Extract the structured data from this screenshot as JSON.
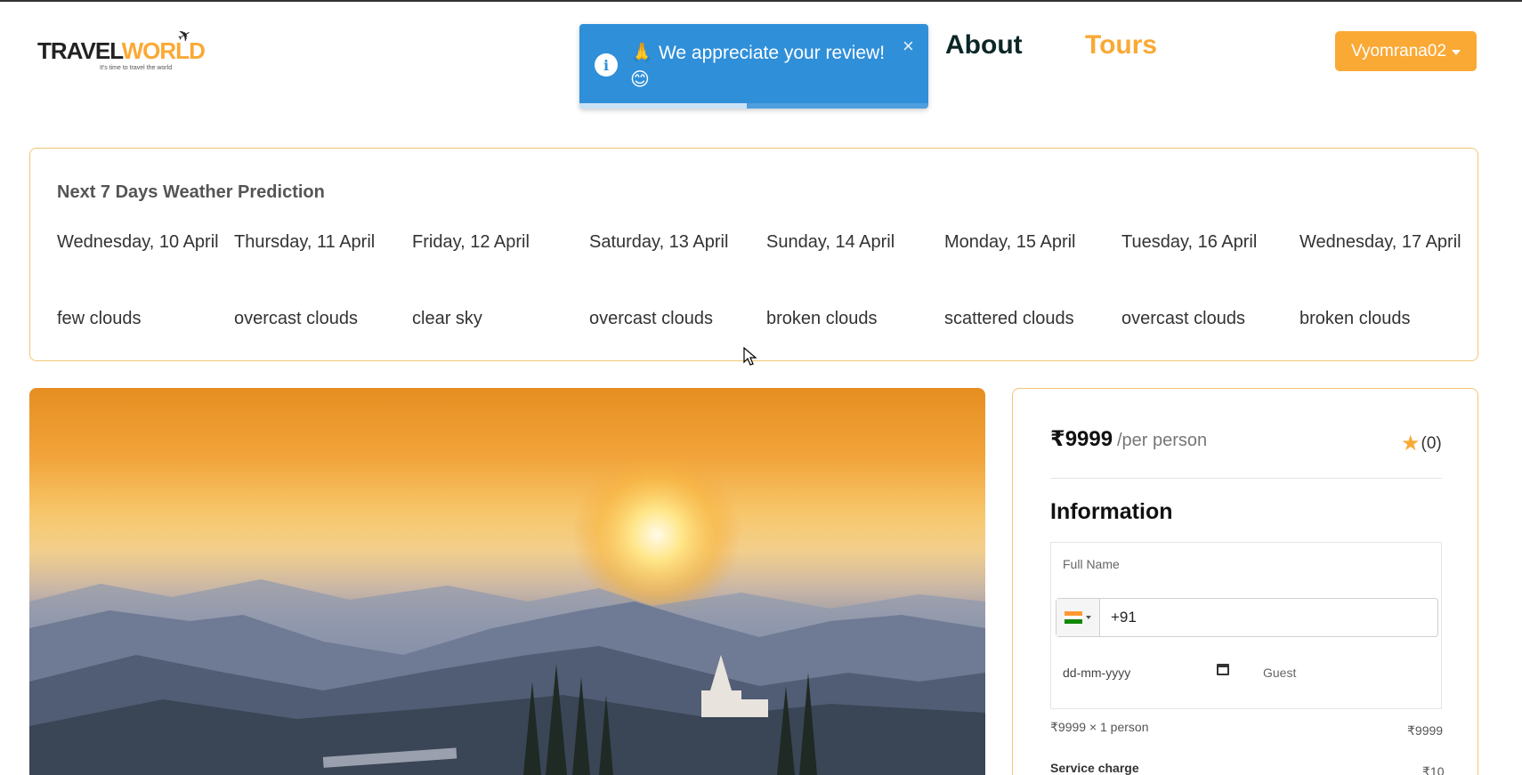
{
  "header": {
    "logo": {
      "part1": "TRAVEL",
      "part2": "WORLD",
      "tagline": "It's time to travel the world"
    },
    "nav": {
      "about": "About",
      "tours": "Tours"
    },
    "user": {
      "name": "Vyomrana02"
    }
  },
  "toast": {
    "message": "🙏 We appreciate your review! 😊",
    "close": "×",
    "progress_fraction": 0.48,
    "info_glyph": "i"
  },
  "weather": {
    "title": "Next 7 Days Weather Prediction",
    "days": [
      {
        "date": "Wednesday, 10 April",
        "desc": "few clouds"
      },
      {
        "date": "Thursday, 11 April",
        "desc": "overcast clouds"
      },
      {
        "date": "Friday, 12 April",
        "desc": "clear sky"
      },
      {
        "date": "Saturday, 13 April",
        "desc": "overcast clouds"
      },
      {
        "date": "Sunday, 14 April",
        "desc": "broken clouds"
      },
      {
        "date": "Monday, 15 April",
        "desc": "scattered clouds"
      },
      {
        "date": "Tuesday, 16 April",
        "desc": "overcast clouds"
      },
      {
        "date": "Wednesday, 17 April",
        "desc": "broken clouds"
      }
    ]
  },
  "booking": {
    "price": "₹9999",
    "per": "/per person",
    "rating": "(0)",
    "info_title": "Information",
    "fullname_placeholder": "Full Name",
    "phone_code": "+91",
    "date_placeholder": "dd-mm-yyyy",
    "guest_placeholder": "Guest",
    "calc_label": "₹9999  ×  1 person",
    "calc_total": "₹9999",
    "service_label": "Service charge",
    "service_value": "₹10"
  },
  "colors": {
    "accent": "#faa935",
    "toast": "#2f8fd9",
    "heading": "#0b2727"
  }
}
